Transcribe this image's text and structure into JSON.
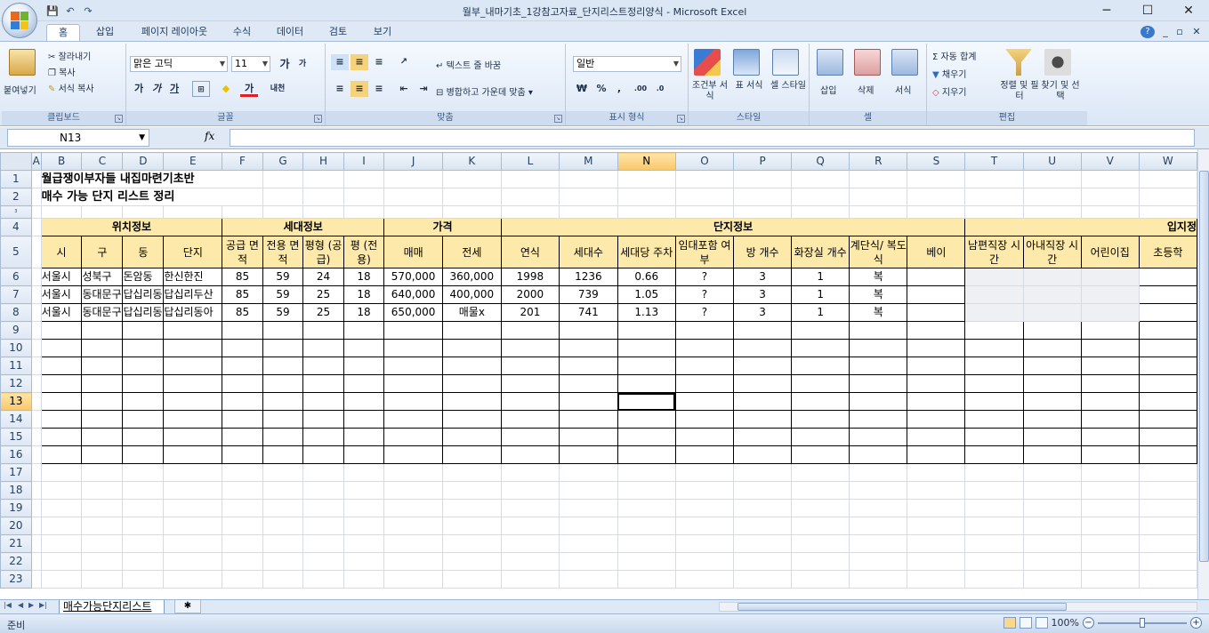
{
  "window": {
    "title": "월부_내마기초_1강참고자료_단지리스트정리양식 - Microsoft Excel"
  },
  "qat": {
    "save": "💾",
    "undo": "↶",
    "redo": "↷"
  },
  "window_controls": {
    "min": "─",
    "max": "☐",
    "close": "✕"
  },
  "ribbon_tabs": [
    "홈",
    "삽입",
    "페이지 레이아웃",
    "수식",
    "데이터",
    "검토",
    "보기"
  ],
  "ribbon_right": {
    "help": "?",
    "min": "_",
    "restore": "▫",
    "close": "✕"
  },
  "clipboard": {
    "paste": "붙여넣기",
    "cut": "잘라내기",
    "copy": "복사",
    "format_painter": "서식 복사",
    "label": "클립보드"
  },
  "font": {
    "name": "맑은 고딕",
    "size": "11",
    "grow": "가",
    "shrink": "가",
    "bold": "가",
    "italic": "가",
    "underline": "가",
    "phonetic": "내천",
    "label": "글꼴"
  },
  "alignment": {
    "wrap": "텍스트 줄 바꿈",
    "merge": "병합하고 가운데 맞춤",
    "label": "맞춤"
  },
  "number": {
    "format": "일반",
    "currency": "₩",
    "percent": "%",
    "comma": ",",
    "inc_decimal": ".00",
    "dec_decimal": ".0",
    "label": "표시 형식"
  },
  "styles": {
    "conditional": "조건부 서식",
    "table": "표 서식",
    "cell": "셀 스타일",
    "label": "스타일"
  },
  "cells": {
    "insert": "삽입",
    "delete": "삭제",
    "format": "서식",
    "label": "셀"
  },
  "editing": {
    "autosum": "Σ 자동 합계",
    "fill": "채우기",
    "clear": "지우기",
    "sort": "정렬 및 필터",
    "find": "찾기 및 선택",
    "label": "편집"
  },
  "formula_bar": {
    "name_box": "N13",
    "fx": "fx",
    "value": ""
  },
  "columns": [
    "A",
    "B",
    "C",
    "D",
    "E",
    "F",
    "G",
    "H",
    "I",
    "J",
    "K",
    "L",
    "M",
    "N",
    "O",
    "P",
    "Q",
    "R",
    "S",
    "T",
    "U",
    "V",
    "W"
  ],
  "selected_column": "N",
  "selected_row": "13",
  "sheet": {
    "title1": "월급쟁이부자들 내집마련기초반",
    "title2": "매수 가능 단지 리스트 정리",
    "groups": {
      "location": "위치정보",
      "household": "세대정보",
      "price": "가격",
      "complex": "단지정보",
      "area": "입지정"
    },
    "headers": {
      "B": "시",
      "C": "구",
      "D": "동",
      "E": "단지",
      "F": "공급 면적",
      "G": "전용 면적",
      "H": "평형 (공급)",
      "I": "평 (전용)",
      "J": "매매",
      "K": "전세",
      "L": "연식",
      "M": "세대수",
      "N": "세대당 주차",
      "O": "임대포함 여부",
      "P": "방 개수",
      "Q": "화장실 개수",
      "R": "계단식/ 복도식",
      "S": "베이",
      "T": "남편직장 시간",
      "U": "아내직장 시간",
      "V": "어린이집",
      "W": "초등학"
    },
    "rows": [
      {
        "B": "서울시",
        "C": "성북구",
        "D": "돈암동",
        "E": "한신한진",
        "F": "85",
        "G": "59",
        "H": "24",
        "I": "18",
        "J": "570,000",
        "K": "360,000",
        "L": "1998",
        "M": "1236",
        "N": "0.66",
        "O": "?",
        "P": "3",
        "Q": "1",
        "R": "복",
        "W": ""
      },
      {
        "B": "서울시",
        "C": "동대문구",
        "D": "답십리동",
        "E": "답십리두산",
        "F": "85",
        "G": "59",
        "H": "25",
        "I": "18",
        "J": "640,000",
        "K": "400,000",
        "L": "2000",
        "M": "739",
        "N": "1.05",
        "O": "?",
        "P": "3",
        "Q": "1",
        "R": "복",
        "W": ""
      },
      {
        "B": "서울시",
        "C": "동대문구",
        "D": "답십리동",
        "E": "답십리동아",
        "F": "85",
        "G": "59",
        "H": "25",
        "I": "18",
        "J": "650,000",
        "K": "매물x",
        "L": "201",
        "M": "741",
        "N": "1.13",
        "O": "?",
        "P": "3",
        "Q": "1",
        "R": "복",
        "W": ""
      }
    ],
    "empty_rows": [
      "9",
      "10",
      "11",
      "12",
      "13",
      "14",
      "15",
      "16",
      "17",
      "18",
      "19",
      "20",
      "21",
      "22",
      "23"
    ]
  },
  "sheet_tab": {
    "name": "매수가능단지리스트",
    "new": "✱"
  },
  "status": {
    "ready": "준비",
    "zoom": "100%",
    "zoom_out": "−",
    "zoom_in": "+"
  }
}
